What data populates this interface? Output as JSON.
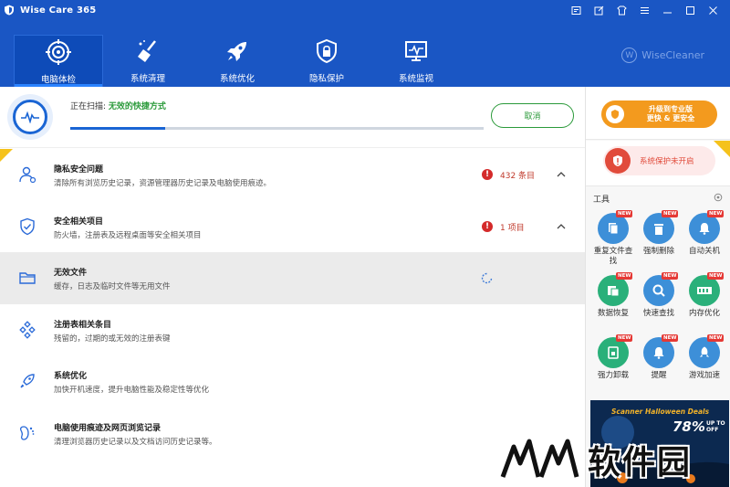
{
  "app": {
    "title": "Wise Care 365",
    "brand": "WiseCleaner",
    "brand_letter": "W"
  },
  "nav": {
    "items": [
      {
        "label": "电脑体检",
        "icon": "target-icon",
        "active": true
      },
      {
        "label": "系统清理",
        "icon": "broom-icon",
        "active": false
      },
      {
        "label": "系统优化",
        "icon": "rocket-icon",
        "active": false
      },
      {
        "label": "隐私保护",
        "icon": "shield-lock-icon",
        "active": false
      },
      {
        "label": "系统监视",
        "icon": "monitor-icon",
        "active": false
      }
    ]
  },
  "scan": {
    "status_prefix": "正在扫描:",
    "status_current": "无效的快捷方式",
    "progress": 0.23,
    "cancel_label": "取消"
  },
  "items": [
    {
      "title": "隐私安全问题",
      "desc": "清除所有浏览历史记录，资源管理器历史记录及电脑使用痕迹。",
      "icon": "user-icon",
      "count": "432 条目",
      "state": "done"
    },
    {
      "title": "安全相关项目",
      "desc": "防火墙，注册表及远程桌面等安全相关项目",
      "icon": "shield-check-icon",
      "count": "1 项目",
      "state": "done"
    },
    {
      "title": "无效文件",
      "desc": "缓存，日志及临时文件等无用文件",
      "icon": "folder-icon",
      "count": "",
      "state": "scanning"
    },
    {
      "title": "注册表相关条目",
      "desc": "残留的，过期的或无效的注册表键",
      "icon": "registry-icon",
      "count": "",
      "state": "pending"
    },
    {
      "title": "系统优化",
      "desc": "加快开机速度，提升电脑性能及稳定性等优化",
      "icon": "rocket-small-icon",
      "count": "",
      "state": "pending"
    },
    {
      "title": "电脑使用痕迹及网页浏览记录",
      "desc": "清理浏览器历史记录以及文档访问历史记录等。",
      "icon": "footprint-icon",
      "count": "",
      "state": "pending"
    }
  ],
  "right": {
    "upgrade_line1": "升级到专业版",
    "upgrade_line2": "更快 & 更安全",
    "protect_label": "系统保护未开启",
    "tools_header": "工具",
    "new_badge": "NEW",
    "tools": [
      {
        "label": "重复文件查找",
        "color": "#3d8fd8",
        "icon": "duplicate-file-icon",
        "new": true
      },
      {
        "label": "强制删除",
        "color": "#3d8fd8",
        "icon": "trash-icon",
        "new": true
      },
      {
        "label": "自动关机",
        "color": "#3d8fd8",
        "icon": "bell-icon",
        "new": true
      },
      {
        "label": "数据恢复",
        "color": "#2ab07a",
        "icon": "data-recovery-icon",
        "new": true
      },
      {
        "label": "快速查找",
        "color": "#3d8fd8",
        "icon": "magnifier-icon",
        "new": true
      },
      {
        "label": "内存优化",
        "color": "#2ab07a",
        "icon": "memory-icon",
        "new": true
      },
      {
        "label": "强力卸载",
        "color": "#2ab07a",
        "icon": "uninstall-icon",
        "new": true
      },
      {
        "label": "提醒",
        "color": "#3d8fd8",
        "icon": "reminder-icon",
        "new": true
      },
      {
        "label": "游戏加速",
        "color": "#3d8fd8",
        "icon": "game-boost-icon",
        "new": true
      }
    ],
    "ad": {
      "title": "Scanner Halloween Deals",
      "percent": "78%",
      "upto": "UP TO",
      "off": "OFF"
    }
  },
  "watermark": "软件园",
  "colors": {
    "primary": "#1a56c4",
    "accent_green": "#2b9a3a",
    "alert_red": "#d42a2a",
    "upgrade_orange": "#f39a1e"
  }
}
